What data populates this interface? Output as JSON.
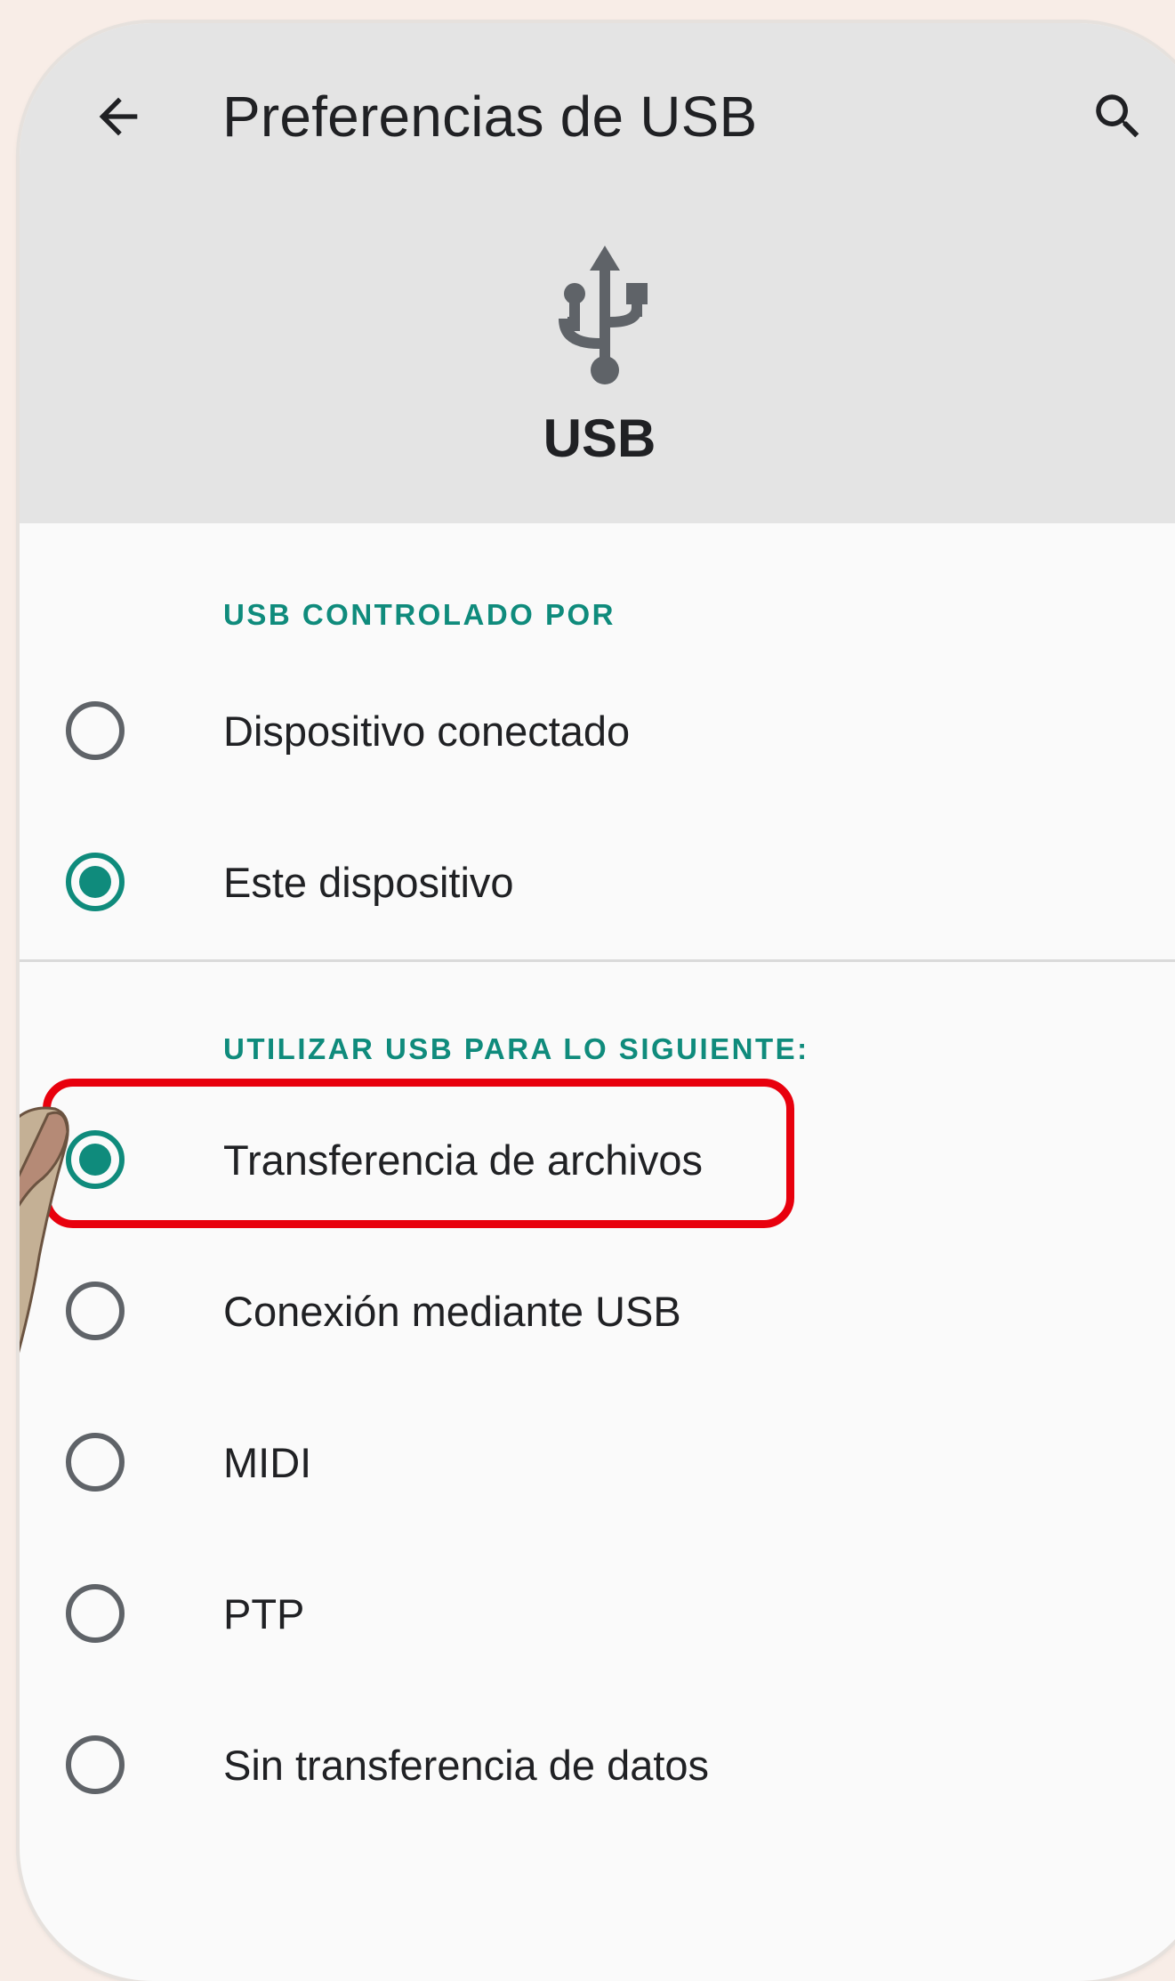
{
  "header": {
    "title": "Preferencias de USB",
    "back_icon": "arrow-back-icon",
    "search_icon": "search-icon"
  },
  "hero": {
    "icon": "usb-icon",
    "label": "USB"
  },
  "usb_controlled_by": {
    "header": "USB CONTROLADO POR",
    "options": [
      {
        "label": "Dispositivo conectado",
        "selected": false
      },
      {
        "label": "Este dispositivo",
        "selected": true
      }
    ]
  },
  "usb_use": {
    "header": "UTILIZAR USB PARA LO SIGUIENTE:",
    "options": [
      {
        "label": "Transferencia de archivos",
        "selected": true
      },
      {
        "label": "Conexión mediante USB",
        "selected": false
      },
      {
        "label": "MIDI",
        "selected": false
      },
      {
        "label": "PTP",
        "selected": false
      },
      {
        "label": "Sin transferencia de datos",
        "selected": false
      }
    ]
  },
  "colors": {
    "accent": "#0f8b7c",
    "header_bg": "#e4e4e4",
    "highlight": "#e8000d",
    "page_bg": "#f8ede7"
  }
}
